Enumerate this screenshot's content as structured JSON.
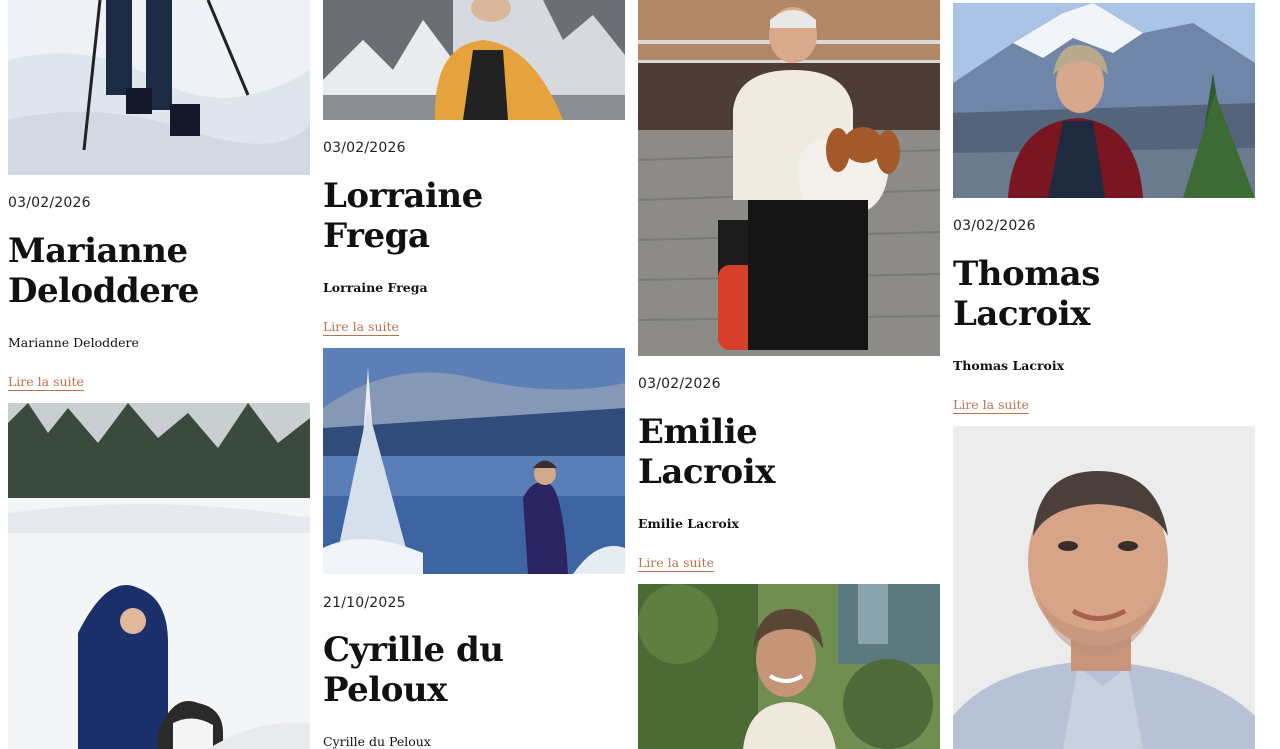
{
  "colors": {
    "link": "#c0714e",
    "text": "#111111",
    "background": "#ffffff"
  },
  "columns": [
    {
      "cards": [
        {
          "photo": "hiker-snow-legs-photo"
        },
        {
          "date": "03/02/2026",
          "title_line1": "Marianne",
          "title_line2": "Deloddere",
          "author": "Marianne Deloddere",
          "read_more": "Lire la suite",
          "photo": "woman-with-dog-in-snow-photo"
        }
      ]
    },
    {
      "cards": [
        {
          "photo": "man-yellow-jacket-mountains-photo"
        },
        {
          "date": "03/02/2026",
          "title_line1": "Lorraine",
          "title_line2": "Frega",
          "author": "Lorraine Frega",
          "read_more": "Lire la suite",
          "photo": "woman-by-frozen-lake-photo"
        },
        {
          "date": "21/10/2025",
          "title_line1": "Cyrille du",
          "title_line2": "Peloux",
          "author": "Cyrille du Peloux"
        }
      ]
    },
    {
      "cards": [
        {
          "photo": "man-wheelchair-with-dog-photo"
        },
        {
          "date": "03/02/2026",
          "title_line1": "Emilie",
          "title_line2": "Lacroix",
          "author": "Emilie Lacroix",
          "read_more": "Lire la suite",
          "photo": "smiling-woman-outdoors-photo"
        }
      ]
    },
    {
      "cards": [
        {
          "photo": "woman-mountain-view-photo"
        },
        {
          "date": "03/02/2026",
          "title_line1": "Thomas",
          "title_line2": "Lacroix",
          "author": "Thomas Lacroix",
          "read_more": "Lire la suite",
          "photo": "man-portrait-grey-background-photo"
        }
      ]
    }
  ]
}
